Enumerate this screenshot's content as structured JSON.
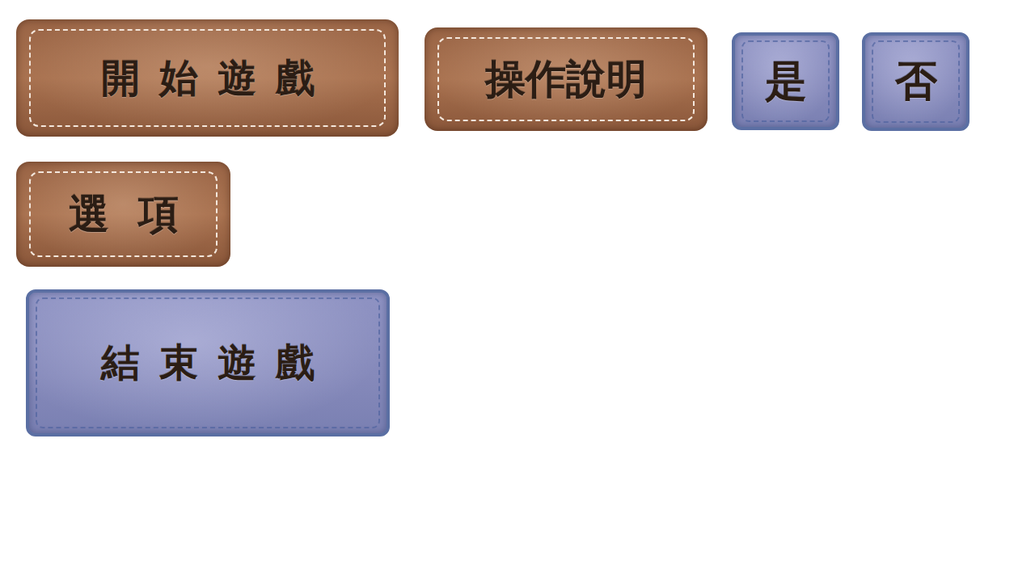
{
  "rows": [
    [
      {
        "label": "開始遊戲",
        "kind": "brown"
      },
      {
        "label": "操作說明",
        "kind": "brown"
      },
      {
        "label": "是",
        "kind": "blue"
      },
      {
        "label": "否",
        "kind": "blue"
      }
    ],
    [
      {
        "label": "選項",
        "kind": "brown"
      }
    ],
    [
      {
        "label": "結束遊戲",
        "kind": "blue"
      }
    ]
  ]
}
